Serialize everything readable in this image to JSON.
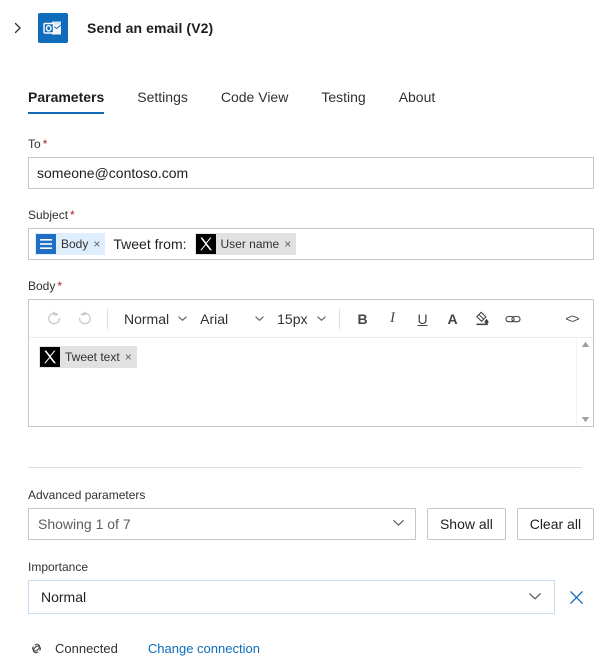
{
  "header": {
    "expand_icon": "chevron-right-icon",
    "app_icon": "outlook-icon",
    "title": "Send an email (V2)"
  },
  "tabs": [
    {
      "label": "Parameters",
      "active": true
    },
    {
      "label": "Settings",
      "active": false
    },
    {
      "label": "Code View",
      "active": false
    },
    {
      "label": "Testing",
      "active": false
    },
    {
      "label": "About",
      "active": false
    }
  ],
  "fields": {
    "to": {
      "label": "To",
      "required": "*",
      "value": "someone@contoso.com"
    },
    "subject": {
      "label": "Subject",
      "required": "*",
      "token_body": {
        "icon": "body-lines-icon",
        "text": "Body",
        "remove": "×"
      },
      "static_text": "Tweet from:",
      "token_user": {
        "icon": "x-twitter-icon",
        "text": "User name",
        "remove": "×"
      }
    },
    "body": {
      "label": "Body",
      "required": "*",
      "toolbar": {
        "undo": "undo-icon",
        "redo": "redo-icon",
        "style": "Normal",
        "font": "Arial",
        "size": "15px",
        "bold": "B",
        "italic": "I",
        "underline": "U",
        "font_color": "A",
        "highlight": "highlight-icon",
        "link": "link-icon",
        "code": "<>"
      },
      "token": {
        "icon": "x-twitter-icon",
        "text": "Tweet text",
        "remove": "×"
      },
      "scroll_up": "scroll-up-arrow",
      "scroll_down": "scroll-down-arrow"
    }
  },
  "advanced": {
    "label": "Advanced parameters",
    "select_value": "Showing 1 of 7",
    "show_all": "Show all",
    "clear_all": "Clear all"
  },
  "importance": {
    "label": "Importance",
    "value": "Normal",
    "clear_icon": "close-x-icon"
  },
  "footer": {
    "status_icon": "connection-icon",
    "status": "Connected",
    "link": "Change connection"
  },
  "colors": {
    "accent": "#0f6cbd",
    "required": "#a4262c",
    "token_blue_bg": "#dfeefc",
    "token_gray_bg": "#e1e1e1",
    "border": "#c8c6c4"
  }
}
